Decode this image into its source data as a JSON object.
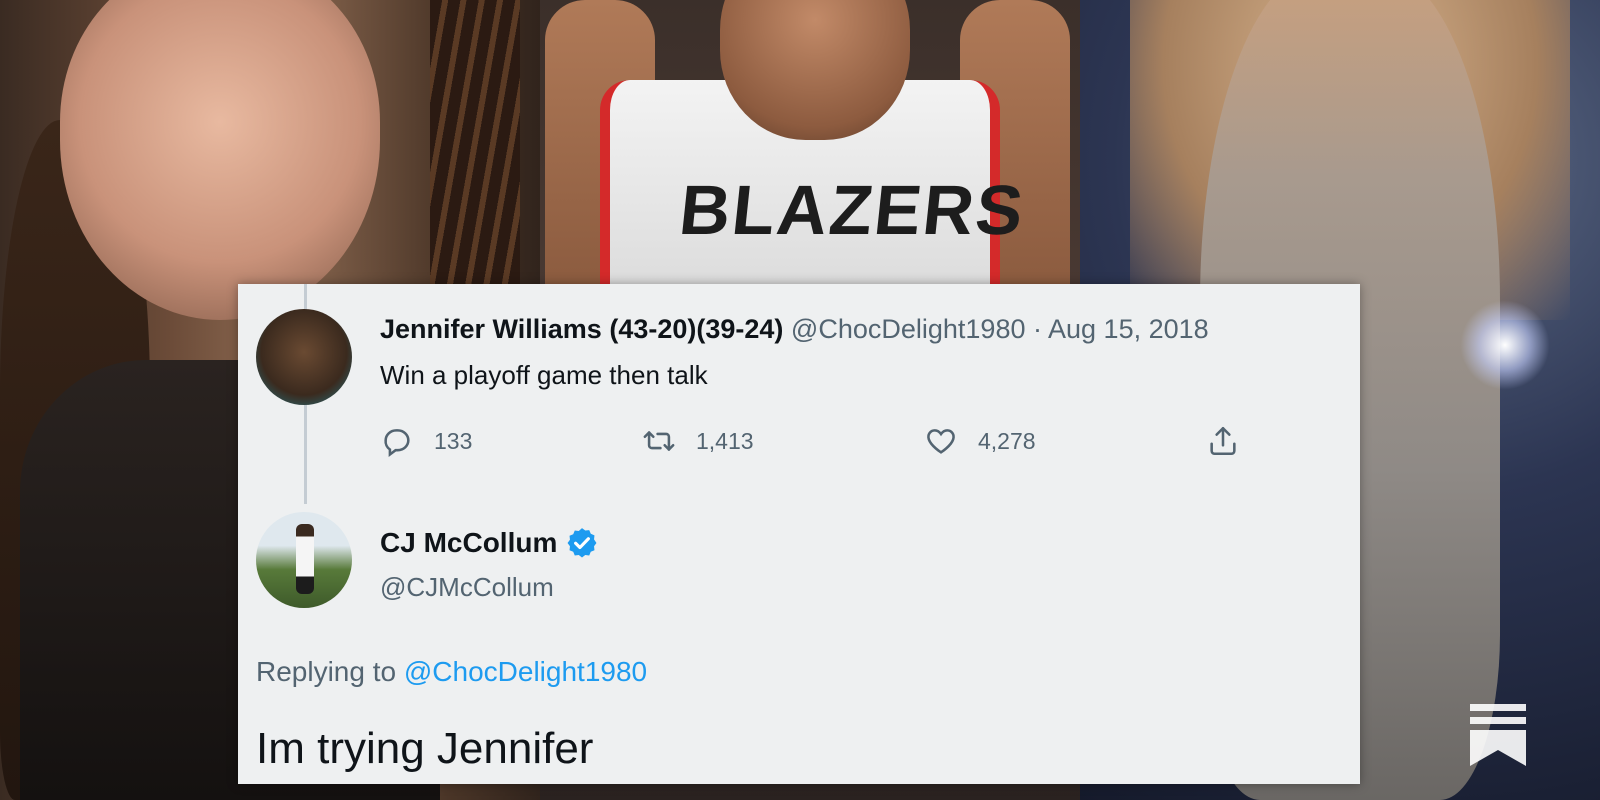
{
  "original_tweet": {
    "author_name": "Jennifer Williams (43-20)(39-24)",
    "handle": "@ChocDelight1980",
    "date": "Aug 15, 2018",
    "text": "Win a playoff game then talk",
    "replies": "133",
    "retweets": "1,413",
    "likes": "4,278"
  },
  "reply_tweet": {
    "author_name": "CJ McCollum",
    "handle": "@CJMcCollum",
    "replying_prefix": "Replying to",
    "replying_to": "@ChocDelight1980",
    "text": "Im trying Jennifer"
  },
  "background": {
    "jersey_text": "BLAZERS"
  },
  "icons": {
    "reply": "reply-icon",
    "retweet": "retweet-icon",
    "like": "heart-icon",
    "share": "share-icon",
    "verified": "verified-badge-icon",
    "bookmark": "bookmark-icon"
  },
  "colors": {
    "link": "#1d9bf0",
    "muted": "#536471",
    "verified": "#1d9bf0",
    "card_bg": "#eef0f1"
  }
}
